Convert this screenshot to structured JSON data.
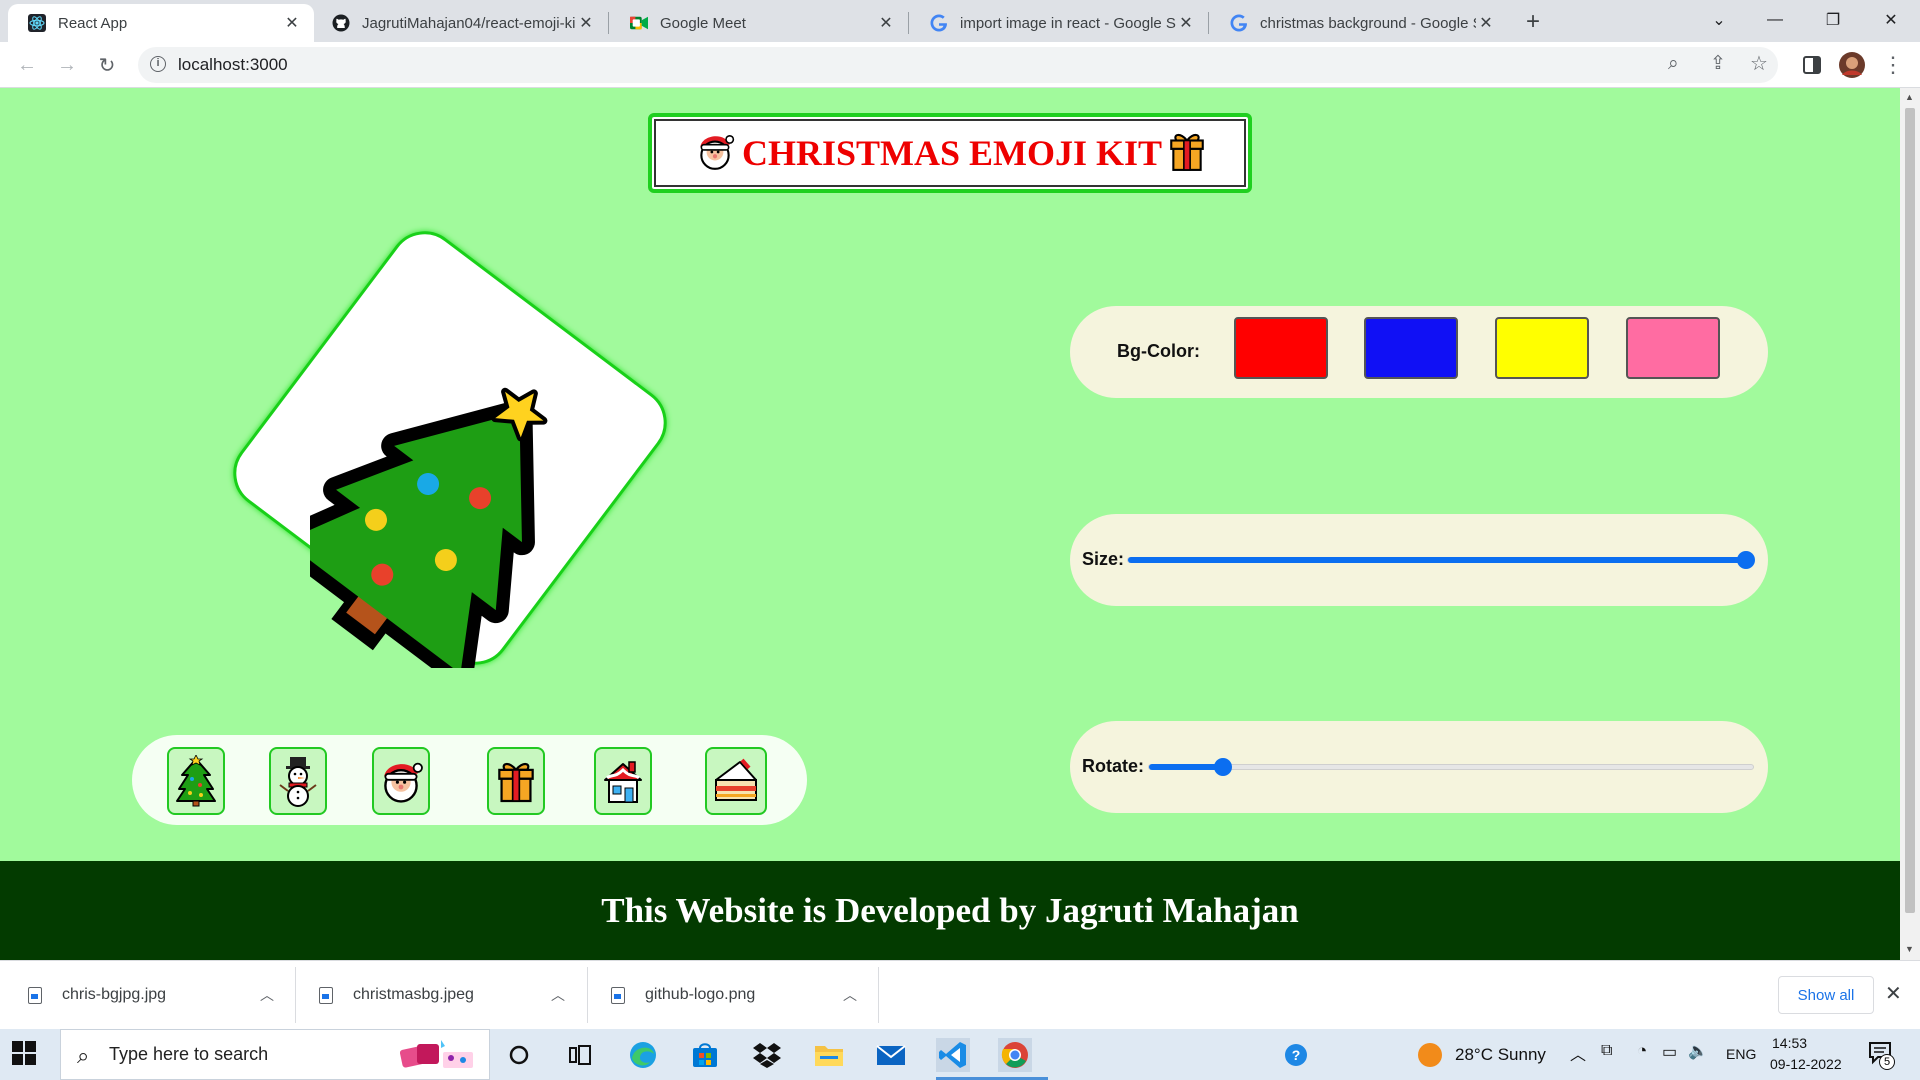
{
  "browser": {
    "tabs": [
      {
        "title": "React App",
        "active": true
      },
      {
        "title": "JagrutiMahajan04/react-emoji-ki",
        "active": false
      },
      {
        "title": "Google Meet",
        "active": false
      },
      {
        "title": "import image in react - Google S",
        "active": false
      },
      {
        "title": "christmas background - Google S",
        "active": false
      }
    ],
    "new_tab_label": "+",
    "url": "localhost:3000"
  },
  "page": {
    "title": "CHRISTMAS EMOJI KIT",
    "bg_color_label": "Bg-Color:",
    "bg_colors": [
      "#ff0000",
      "#1010f5",
      "#ffff00",
      "#ff6ca2"
    ],
    "size_label": "Size:",
    "size_value": 1.0,
    "rotate_label": "Rotate:",
    "rotate_value": 0.11,
    "emoji_options": [
      "christmas-tree",
      "snowman",
      "santa",
      "gift",
      "house",
      "cake"
    ],
    "selected_emoji": "christmas-tree",
    "footer": "This Website is Developed by Jagruti Mahajan",
    "colors": {
      "page_bg": "#a1fa9c",
      "footer_bg": "#033b00",
      "title_red": "#ee0000"
    }
  },
  "downloads": {
    "items": [
      "chris-bgjpg.jpg",
      "christmasbg.jpeg",
      "github-logo.png"
    ],
    "show_all": "Show all"
  },
  "taskbar": {
    "search_placeholder": "Type here to search",
    "weather": "28°C  Sunny",
    "language": "ENG",
    "time": "14:53",
    "date": "09-12-2022",
    "notifications": "5"
  }
}
